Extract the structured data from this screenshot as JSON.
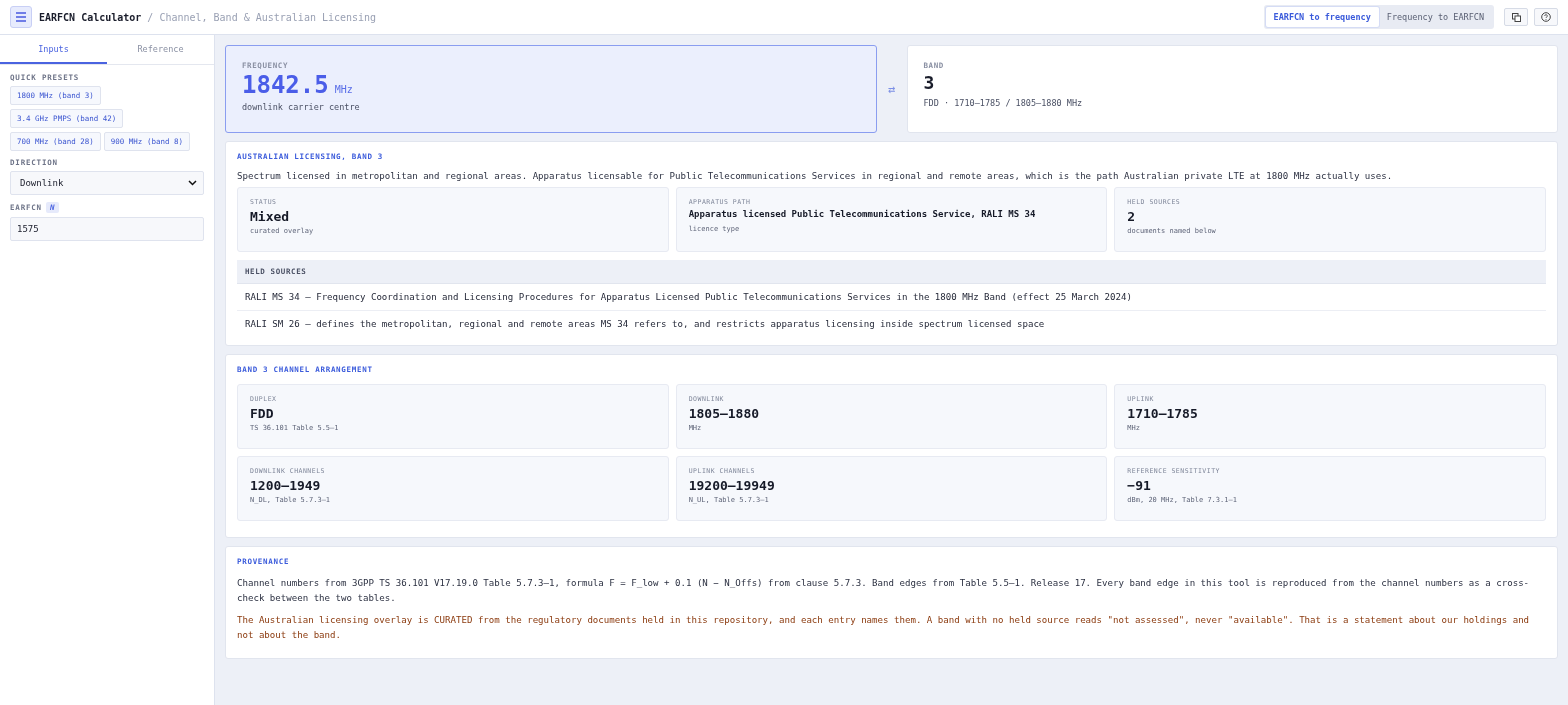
{
  "header": {
    "title": "EARFCN Calculator",
    "separator": "/",
    "subtitle": "Channel, Band & Australian Licensing",
    "modes": [
      {
        "label": "EARFCN to frequency",
        "selected": true
      },
      {
        "label": "Frequency to EARFCN",
        "selected": false
      }
    ]
  },
  "sidebar": {
    "tabs": [
      {
        "label": "Inputs",
        "selected": true
      },
      {
        "label": "Reference",
        "selected": false
      }
    ],
    "presets_label": "QUICK PRESETS",
    "presets": [
      [
        "1800 MHz (band 3)"
      ],
      [
        "3.4 GHz PMPS (band 42)"
      ],
      [
        "700 MHz (band 28)",
        "900 MHz (band 8)"
      ]
    ],
    "direction_label": "DIRECTION",
    "direction": "Downlink",
    "earfcn_label": "EARFCN",
    "earfcn_badge": "N",
    "earfcn": "1575"
  },
  "frequency": {
    "label": "FREQUENCY",
    "value": "1842.5",
    "unit": "MHz",
    "caption": "downlink carrier centre"
  },
  "swap": "⇄",
  "band": {
    "label": "BAND",
    "value": "3",
    "caption": "FDD · 1710–1785 / 1805–1880 MHz"
  },
  "licensing": {
    "title": "AUSTRALIAN LICENSING, BAND 3",
    "summary": "Spectrum licensed in metropolitan and regional areas. Apparatus licensable for Public Telecommunications Services in regional and remote areas, which is the path Australian private LTE at 1800 MHz actually uses.",
    "stats": [
      {
        "kind": "big",
        "label": "STATUS",
        "value": "Mixed",
        "caption": "curated overlay"
      },
      {
        "kind": "text",
        "label": "APPARATUS PATH",
        "value": "Apparatus licensed Public Telecommunications Service, RALI MS 34",
        "caption": "licence type"
      },
      {
        "kind": "big",
        "label": "HELD SOURCES",
        "value": "2",
        "caption": "documents named below"
      }
    ],
    "sources_heading": "HELD SOURCES",
    "sources": [
      "RALI MS 34 — Frequency Coordination and Licensing Procedures for Apparatus Licensed Public Telecommunications Services in the 1800 MHz Band (effect 25 March 2024)",
      "RALI SM 26 — defines the metropolitan, regional and remote areas MS 34 refers to, and restricts apparatus licensing inside spectrum licensed space"
    ]
  },
  "arrangement": {
    "title": "BAND 3 CHANNEL ARRANGEMENT",
    "stats": [
      {
        "label": "DUPLEX",
        "value": "FDD",
        "caption": "TS 36.101 Table 5.5–1"
      },
      {
        "label": "DOWNLINK",
        "value": "1805–1880",
        "caption": "MHz"
      },
      {
        "label": "UPLINK",
        "value": "1710–1785",
        "caption": "MHz"
      },
      {
        "label": "DOWNLINK CHANNELS",
        "value": "1200–1949",
        "caption": "N_DL, Table 5.7.3–1"
      },
      {
        "label": "UPLINK CHANNELS",
        "value": "19200–19949",
        "caption": "N_UL, Table 5.7.3–1"
      },
      {
        "label": "REFERENCE SENSITIVITY",
        "value": "−91",
        "caption": "dBm, 20 MHz, Table 7.3.1–1"
      }
    ]
  },
  "provenance": {
    "title": "PROVENANCE",
    "paragraphs": [
      {
        "kind": "note",
        "text": "Channel numbers from 3GPP TS 36.101 V17.19.0 Table 5.7.3–1, formula F = F_low + 0.1 (N − N_Offs) from clause 5.7.3. Band edges from Table 5.5–1. Release 17. Every band edge in this tool is reproduced from the channel numbers as a cross-check between the two tables."
      },
      {
        "kind": "warning",
        "text": "The Australian licensing overlay is CURATED from the regulatory documents held in this repository, and each entry names them. A band with no held source reads \"not assessed\", never \"available\". That is a statement about our holdings and not about the band."
      }
    ]
  }
}
